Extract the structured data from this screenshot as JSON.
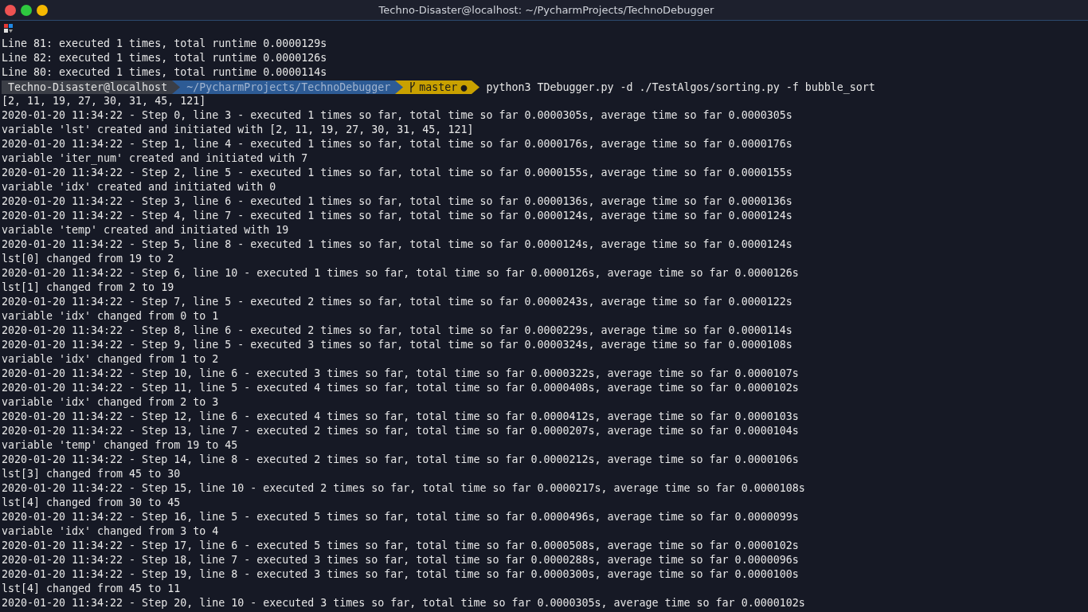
{
  "window": {
    "title": "Techno-Disaster@localhost: ~/PycharmProjects/TechnoDebugger",
    "controls": [
      {
        "color": "#ee5252"
      },
      {
        "color": "#2ec83f"
      },
      {
        "color": "#f5b800"
      }
    ]
  },
  "before": [
    "Line 81: executed 1 times, total runtime 0.0000129s",
    "Line 82: executed 1 times, total runtime 0.0000126s",
    "Line 80: executed 1 times, total runtime 0.0000114s"
  ],
  "prompt": {
    "user": "Techno-Disaster@localhost",
    "path": "~/PycharmProjects/TechnoDebugger",
    "branch": "master",
    "dirty": "●",
    "command": "python3 TDebugger.py -d ./TestAlgos/sorting.py -f bubble_sort"
  },
  "output": [
    "[2, 11, 19, 27, 30, 31, 45, 121]",
    "2020-01-20 11:34:22 - Step 0, line 3 - executed 1 times so far, total time so far 0.0000305s, average time so far 0.0000305s",
    "variable 'lst' created and initiated with [2, 11, 19, 27, 30, 31, 45, 121]",
    "2020-01-20 11:34:22 - Step 1, line 4 - executed 1 times so far, total time so far 0.0000176s, average time so far 0.0000176s",
    "variable 'iter_num' created and initiated with 7",
    "2020-01-20 11:34:22 - Step 2, line 5 - executed 1 times so far, total time so far 0.0000155s, average time so far 0.0000155s",
    "variable 'idx' created and initiated with 0",
    "2020-01-20 11:34:22 - Step 3, line 6 - executed 1 times so far, total time so far 0.0000136s, average time so far 0.0000136s",
    "2020-01-20 11:34:22 - Step 4, line 7 - executed 1 times so far, total time so far 0.0000124s, average time so far 0.0000124s",
    "variable 'temp' created and initiated with 19",
    "2020-01-20 11:34:22 - Step 5, line 8 - executed 1 times so far, total time so far 0.0000124s, average time so far 0.0000124s",
    "lst[0] changed from 19 to 2",
    "2020-01-20 11:34:22 - Step 6, line 10 - executed 1 times so far, total time so far 0.0000126s, average time so far 0.0000126s",
    "lst[1] changed from 2 to 19",
    "2020-01-20 11:34:22 - Step 7, line 5 - executed 2 times so far, total time so far 0.0000243s, average time so far 0.0000122s",
    "variable 'idx' changed from 0 to 1",
    "2020-01-20 11:34:22 - Step 8, line 6 - executed 2 times so far, total time so far 0.0000229s, average time so far 0.0000114s",
    "2020-01-20 11:34:22 - Step 9, line 5 - executed 3 times so far, total time so far 0.0000324s, average time so far 0.0000108s",
    "variable 'idx' changed from 1 to 2",
    "2020-01-20 11:34:22 - Step 10, line 6 - executed 3 times so far, total time so far 0.0000322s, average time so far 0.0000107s",
    "2020-01-20 11:34:22 - Step 11, line 5 - executed 4 times so far, total time so far 0.0000408s, average time so far 0.0000102s",
    "variable 'idx' changed from 2 to 3",
    "2020-01-20 11:34:22 - Step 12, line 6 - executed 4 times so far, total time so far 0.0000412s, average time so far 0.0000103s",
    "2020-01-20 11:34:22 - Step 13, line 7 - executed 2 times so far, total time so far 0.0000207s, average time so far 0.0000104s",
    "variable 'temp' changed from 19 to 45",
    "2020-01-20 11:34:22 - Step 14, line 8 - executed 2 times so far, total time so far 0.0000212s, average time so far 0.0000106s",
    "lst[3] changed from 45 to 30",
    "2020-01-20 11:34:22 - Step 15, line 10 - executed 2 times so far, total time so far 0.0000217s, average time so far 0.0000108s",
    "lst[4] changed from 30 to 45",
    "2020-01-20 11:34:22 - Step 16, line 5 - executed 5 times so far, total time so far 0.0000496s, average time so far 0.0000099s",
    "variable 'idx' changed from 3 to 4",
    "2020-01-20 11:34:22 - Step 17, line 6 - executed 5 times so far, total time so far 0.0000508s, average time so far 0.0000102s",
    "2020-01-20 11:34:22 - Step 18, line 7 - executed 3 times so far, total time so far 0.0000288s, average time so far 0.0000096s",
    "2020-01-20 11:34:22 - Step 19, line 8 - executed 3 times so far, total time so far 0.0000300s, average time so far 0.0000100s",
    "lst[4] changed from 45 to 11",
    "2020-01-20 11:34:22 - Step 20, line 10 - executed 3 times so far, total time so far 0.0000305s, average time so far 0.0000102s"
  ]
}
